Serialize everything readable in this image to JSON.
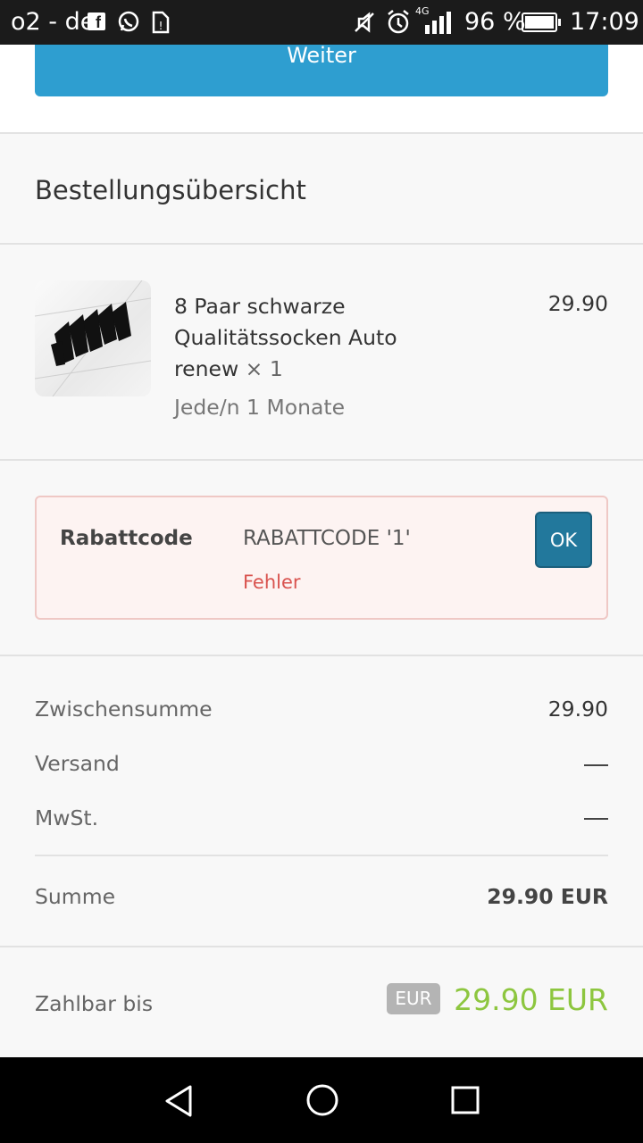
{
  "status_bar": {
    "carrier": "o2 - de",
    "network_type": "4G",
    "battery": "96 %",
    "time": "17:09",
    "icons": [
      "facebook-icon",
      "whatsapp-icon",
      "sim-alert-icon",
      "mute-icon",
      "alarm-icon",
      "signal-icon",
      "battery-icon"
    ]
  },
  "top": {
    "continue_label": "Weiter"
  },
  "summary": {
    "title": "Bestellungsübersicht"
  },
  "product": {
    "name": "8 Paar schwarze Qualitätssocken Auto renew",
    "quantity": "× 1",
    "price": "29.90",
    "interval": "Jede/n 1 Monate"
  },
  "coupon": {
    "label": "Rabattcode",
    "value": "RABATTCODE '1'",
    "error": "Fehler",
    "ok_label": "OK"
  },
  "totals": {
    "subtotal_label": "Zwischensumme",
    "subtotal_value": "29.90",
    "shipping_label": "Versand",
    "tax_label": "MwSt.",
    "sum_label": "Summe",
    "sum_value": "29.90 EUR"
  },
  "due": {
    "label": "Zahlbar bis",
    "currency_badge": "EUR",
    "amount": "29.90 EUR"
  },
  "colors": {
    "accent": "#2e9ed0",
    "ok_button": "#22789c",
    "error": "#d9534f",
    "due_amount": "#8dc63f"
  },
  "nav": {
    "icons": [
      "back-icon",
      "home-icon",
      "recents-icon"
    ]
  }
}
